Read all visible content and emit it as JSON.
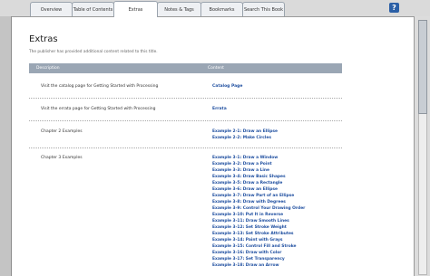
{
  "tabs": [
    {
      "label": "Overview"
    },
    {
      "label": "Table of Contents"
    },
    {
      "label": "Extras"
    },
    {
      "label": "Notes & Tags"
    },
    {
      "label": "Bookmarks"
    },
    {
      "label": "Search This Book"
    }
  ],
  "help_label": "?",
  "page": {
    "title": "Extras",
    "subtitle": "The publisher has provided additional content related to this title."
  },
  "table": {
    "col_description": "Description",
    "col_content": "Content",
    "rows": [
      {
        "desc": "Visit the catalog page for Getting Started with Processing",
        "link": "Catalog Page"
      },
      {
        "desc": "Visit the errata page for Getting Started with Processing",
        "link": "Errata"
      },
      {
        "desc": "Chapter 2 Examples",
        "links": [
          "Example 2-1: Draw an Ellipse",
          "Example 2-2: Make Circles"
        ]
      },
      {
        "desc": "Chapter 3 Examples",
        "links": [
          "Example 3-1: Draw a Window",
          "Example 3-2: Draw a Point",
          "Example 3-3: Draw a Line",
          "Example 3-4: Draw Basic Shapes",
          "Example 3-5: Draw a Rectangle",
          "Example 3-6: Draw an Ellipse",
          "Example 3-7: Draw Part of an Ellipse",
          "Example 3-8: Draw with Degrees",
          "Example 3-9: Control Your Drawing Order",
          "Example 3-10: Put It in Reverse",
          "Example 3-11: Draw Smooth Lines",
          "Example 3-12: Set Stroke Weight",
          "Example 3-13: Set Stroke Attributes",
          "Example 3-14: Paint with Grays",
          "Example 3-15: Control Fill and Stroke",
          "Example 3-16: Draw with Color",
          "Example 3-17: Set Transparency",
          "Example 3-18: Draw an Arrow"
        ]
      }
    ]
  }
}
